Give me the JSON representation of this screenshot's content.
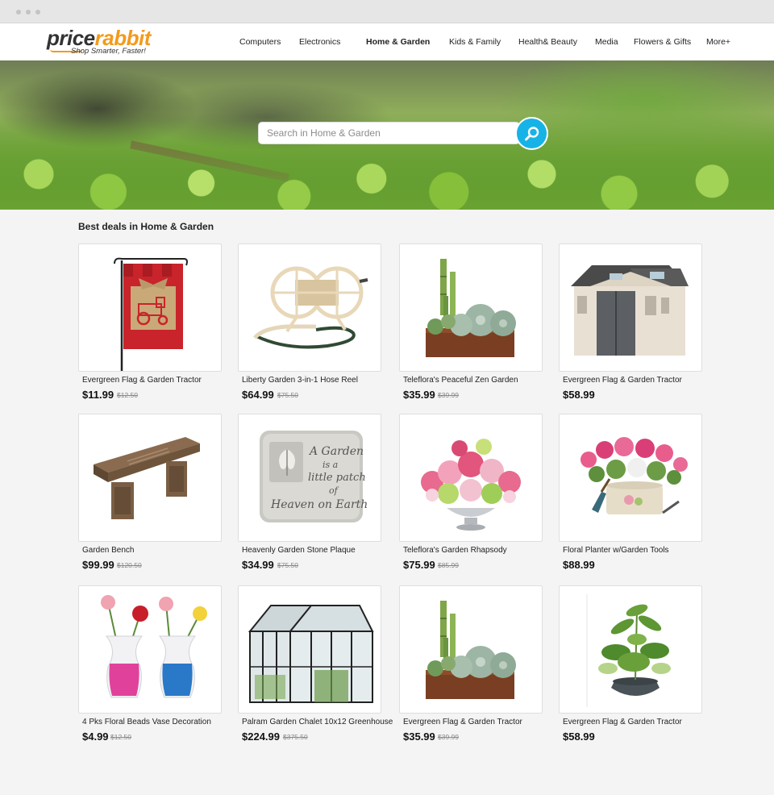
{
  "brand": {
    "name_part1": "price",
    "name_part2": "rabbit",
    "tagline": "Shop Smarter, Faster!"
  },
  "nav": {
    "items": [
      {
        "label": "Computers",
        "active": false
      },
      {
        "label": "Electronics",
        "active": false
      },
      {
        "label": "Home & Garden",
        "active": true
      },
      {
        "label": "Kids & Family",
        "active": false
      },
      {
        "label": "Health& Beauty",
        "active": false
      },
      {
        "label": "Media",
        "active": false
      },
      {
        "label": "Flowers & Gifts",
        "active": false
      },
      {
        "label": "More+",
        "active": false
      }
    ]
  },
  "search": {
    "placeholder": "Search in Home & Garden",
    "value": "",
    "icon": "search-icon"
  },
  "section": {
    "title": "Best deals in Home & Garden"
  },
  "products": [
    {
      "name": "Evergreen Flag & Garden Tractor",
      "price": "$11.99",
      "old_price": "$12.50",
      "image": "garden-flag"
    },
    {
      "name": "Liberty Garden 3-in-1 Hose Reel",
      "price": "$64.99",
      "old_price": "$75.50",
      "image": "hose-reel"
    },
    {
      "name": "Teleflora's Peaceful Zen Garden",
      "price": "$35.99",
      "old_price": "$39.99",
      "image": "zen-garden"
    },
    {
      "name": "Evergreen Flag & Garden Tractor",
      "price": "$58.99",
      "old_price": "",
      "image": "garden-shed"
    },
    {
      "name": "Garden Bench",
      "price": "$99.99",
      "old_price": "$120.50",
      "image": "stone-bench"
    },
    {
      "name": "Heavenly Garden Stone Plaque",
      "price": "$34.99",
      "old_price": "$75.50",
      "image": "stone-plaque",
      "plaque_text": [
        "A Garden",
        "is a",
        "little patch",
        "of",
        "Heaven on Earth"
      ]
    },
    {
      "name": "Teleflora's Garden Rhapsody",
      "price": "$75.99",
      "old_price": "$85.99",
      "image": "flower-bouquet"
    },
    {
      "name": "Floral Planter w/Garden Tools",
      "price": "$88.99",
      "old_price": "",
      "image": "floral-planter"
    },
    {
      "name": "4 Pks Floral Beads Vase Decoration",
      "price": "$4.99",
      "old_price": "$12.50",
      "image": "bead-vases"
    },
    {
      "name": "Palram Garden Chalet 10x12 Greenhouse",
      "price": "$224.99",
      "old_price": "$375.50",
      "image": "greenhouse"
    },
    {
      "name": "Evergreen Flag & Garden Tractor",
      "price": "$35.99",
      "old_price": "$39.99",
      "image": "zen-garden"
    },
    {
      "name": "Evergreen Flag & Garden Tractor",
      "price": "$58.99",
      "old_price": "",
      "image": "potted-plant"
    }
  ],
  "colors": {
    "accent_orange": "#f39a1d",
    "search_blue": "#17b3e6",
    "background": "#f4f4f4"
  }
}
